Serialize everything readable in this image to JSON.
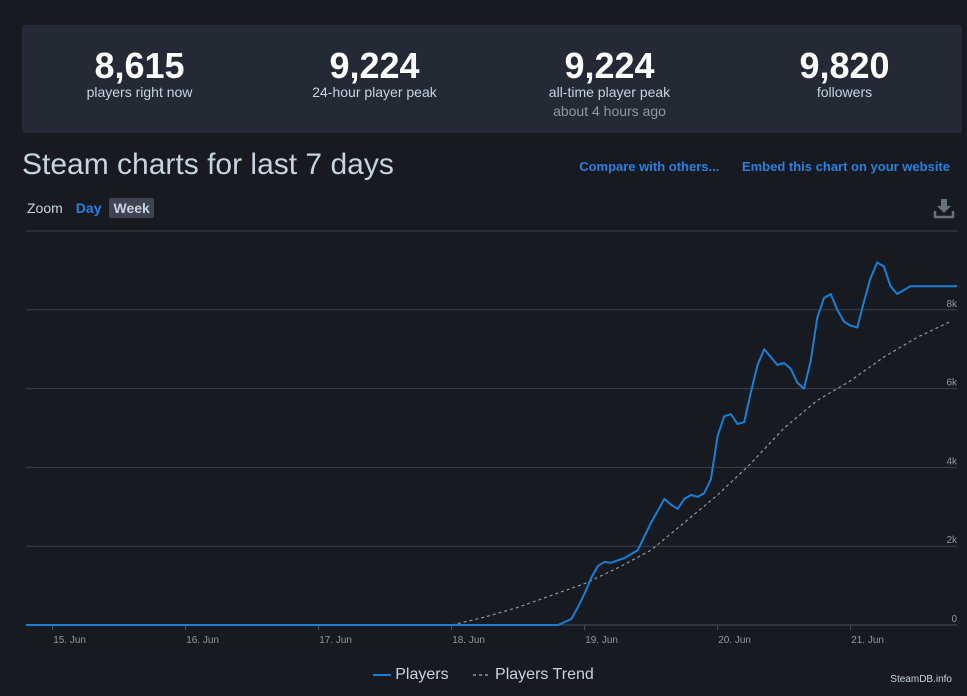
{
  "stats": [
    {
      "value": "8,615",
      "label": "players right now",
      "sub": ""
    },
    {
      "value": "9,224",
      "label": "24-hour player peak",
      "sub": ""
    },
    {
      "value": "9,224",
      "label": "all-time player peak",
      "sub": "about 4 hours ago"
    },
    {
      "value": "9,820",
      "label": "followers",
      "sub": ""
    }
  ],
  "header": {
    "title": "Steam charts for last 7 days",
    "compare_link": "Compare with others...",
    "embed_link": "Embed this chart on your website"
  },
  "zoom": {
    "label": "Zoom",
    "day": "Day",
    "week": "Week"
  },
  "icons": {
    "download": "download-icon"
  },
  "credit": "SteamDB.info",
  "colors": {
    "players": "#1a7fd4",
    "trend": "#8f98a0",
    "grid": "#3a414c",
    "accent": "#2b7fe0"
  },
  "chart_data": {
    "type": "line",
    "title": "",
    "xlabel": "",
    "ylabel": "",
    "ylim": [
      0,
      10000
    ],
    "yticks": [
      0,
      2000,
      4000,
      6000,
      8000
    ],
    "ytick_labels": [
      "0",
      "2k",
      "4k",
      "6k",
      "8k"
    ],
    "xlim": [
      14.8,
      21.8
    ],
    "xticks": [
      15,
      16,
      17,
      18,
      19,
      20,
      21
    ],
    "xtick_labels": [
      "15. Jun",
      "16. Jun",
      "17. Jun",
      "18. Jun",
      "19. Jun",
      "20. Jun",
      "21. Jun"
    ],
    "legend": "bottom-center",
    "grid": true,
    "series": [
      {
        "name": "Players",
        "x": [
          14.8,
          18.8,
          18.9,
          18.95,
          19.0,
          19.05,
          19.1,
          19.15,
          19.2,
          19.3,
          19.4,
          19.5,
          19.55,
          19.6,
          19.65,
          19.7,
          19.75,
          19.8,
          19.85,
          19.9,
          19.95,
          20.0,
          20.05,
          20.1,
          20.15,
          20.2,
          20.25,
          20.3,
          20.35,
          20.4,
          20.45,
          20.5,
          20.55,
          20.6,
          20.65,
          20.7,
          20.75,
          20.8,
          20.85,
          20.9,
          20.95,
          21.0,
          21.05,
          21.1,
          21.15,
          21.2,
          21.25,
          21.3,
          21.35,
          21.4,
          21.45,
          21.5,
          21.55,
          21.6,
          21.65,
          21.7,
          21.75,
          21.8
        ],
        "y": [
          0,
          0,
          150,
          450,
          800,
          1200,
          1500,
          1600,
          1580,
          1700,
          1900,
          2600,
          2900,
          3200,
          3050,
          2950,
          3200,
          3300,
          3250,
          3350,
          3700,
          4800,
          5300,
          5350,
          5100,
          5150,
          5900,
          6600,
          7000,
          6800,
          6600,
          6650,
          6500,
          6150,
          6000,
          6700,
          7800,
          8300,
          8400,
          8000,
          7700,
          7600,
          7550,
          8200,
          8800,
          9200,
          9100,
          8600,
          8400,
          8500,
          8600,
          8600,
          8600,
          8600,
          8600,
          8600,
          8600,
          8600
        ]
      },
      {
        "name": "Players Trend",
        "x": [
          14.8,
          18.0,
          18.25,
          18.5,
          18.75,
          19.0,
          19.25,
          19.5,
          19.75,
          20.0,
          20.25,
          20.5,
          20.75,
          21.0,
          21.25,
          21.5,
          21.75
        ],
        "y": [
          0,
          0,
          200,
          450,
          750,
          1050,
          1450,
          1900,
          2600,
          3300,
          4100,
          5000,
          5700,
          6200,
          6800,
          7300,
          7700
        ]
      }
    ]
  }
}
